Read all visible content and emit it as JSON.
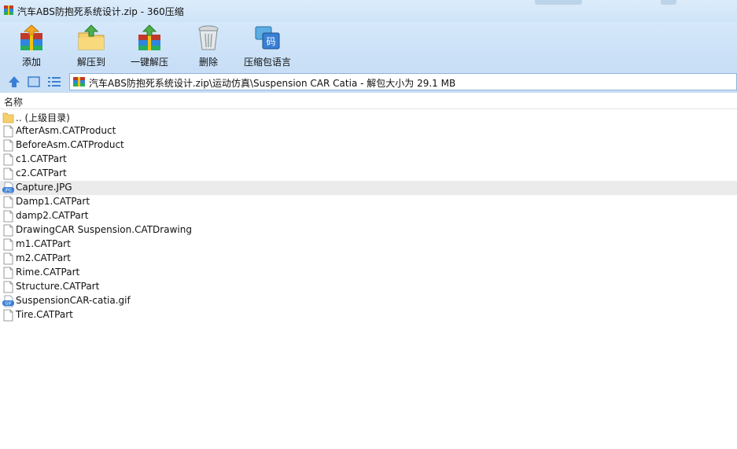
{
  "window": {
    "title": "汽车ABS防抱死系统设计.zip - 360压缩",
    "app_icon": "winrar-archive-icon"
  },
  "toolbar": {
    "buttons": [
      {
        "label": "添加",
        "icon": "add-books-icon"
      },
      {
        "label": "解压到",
        "icon": "extract-folder-icon"
      },
      {
        "label": "一键解压",
        "icon": "one-click-extract-icon"
      },
      {
        "label": "删除",
        "icon": "trash-can-icon"
      },
      {
        "label": "压缩包语言",
        "icon": "archive-language-icon"
      }
    ],
    "language_glyph": "码"
  },
  "nav": {
    "icons": [
      "up-arrow-icon",
      "view-thumbnail-icon",
      "view-list-icon"
    ],
    "address": "汽车ABS防抱死系统设计.zip\\运动仿真\\Suspension CAR Catia - 解包大小为 29.1 MB"
  },
  "list": {
    "column_header": "名称",
    "items": [
      {
        "name": ".. (上级目录)",
        "type": "folder"
      },
      {
        "name": "AfterAsm.CATProduct",
        "type": "file"
      },
      {
        "name": "BeforeAsm.CATProduct",
        "type": "file"
      },
      {
        "name": "c1.CATPart",
        "type": "file"
      },
      {
        "name": "c2.CATPart",
        "type": "file"
      },
      {
        "name": "Capture.JPG",
        "type": "jpg",
        "badge": "JPG",
        "selected": true
      },
      {
        "name": "Damp1.CATPart",
        "type": "file"
      },
      {
        "name": "damp2.CATPart",
        "type": "file"
      },
      {
        "name": "DrawingCAR Suspension.CATDrawing",
        "type": "file"
      },
      {
        "name": "m1.CATPart",
        "type": "file"
      },
      {
        "name": "m2.CATPart",
        "type": "file"
      },
      {
        "name": "Rime.CATPart",
        "type": "file"
      },
      {
        "name": "Structure.CATPart",
        "type": "file"
      },
      {
        "name": "SuspensionCAR-catia.gif",
        "type": "gif",
        "badge": "GIF"
      },
      {
        "name": "Tire.CATPart",
        "type": "file"
      }
    ]
  },
  "colors": {
    "toolbar_bg": "#c7def6",
    "selected_row": "#ebebeb",
    "accent_blue": "#3a7fd5",
    "folder_yellow": "#f6cf6a"
  }
}
